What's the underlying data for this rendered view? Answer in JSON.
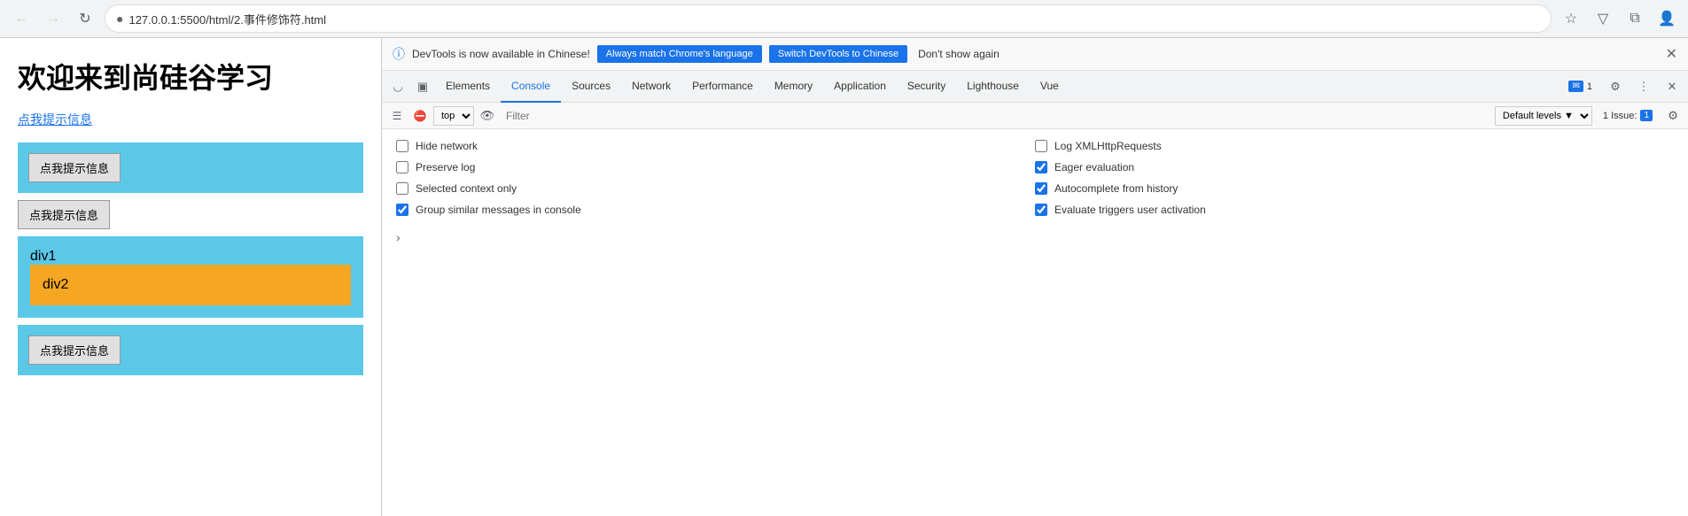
{
  "browser": {
    "url": "127.0.0.1:5500/html/2.事件修饰符.html",
    "back_title": "Back",
    "forward_title": "Forward",
    "refresh_title": "Refresh"
  },
  "webpage": {
    "title": "欢迎来到尚硅谷学习",
    "link_text": "点我提示信息",
    "btn1_label": "点我提示信息",
    "btn2_label": "点我提示信息",
    "btn3_label": "点我提示信息",
    "div1_label": "div1",
    "div2_label": "div2"
  },
  "devtools": {
    "notification": {
      "info_text": "DevTools is now available in Chinese!",
      "btn1_label": "Always match Chrome's language",
      "btn2_label": "Switch DevTools to Chinese",
      "dont_show_label": "Don't show again"
    },
    "tabs": [
      {
        "label": "Elements",
        "active": false
      },
      {
        "label": "Console",
        "active": true
      },
      {
        "label": "Sources",
        "active": false
      },
      {
        "label": "Network",
        "active": false
      },
      {
        "label": "Performance",
        "active": false
      },
      {
        "label": "Memory",
        "active": false
      },
      {
        "label": "Application",
        "active": false
      },
      {
        "label": "Security",
        "active": false
      },
      {
        "label": "Lighthouse",
        "active": false
      },
      {
        "label": "Vue",
        "active": false
      }
    ],
    "issues_badge": "1",
    "console_toolbar": {
      "top_label": "top",
      "filter_placeholder": "Filter",
      "default_levels_label": "Default levels ▼",
      "issue_label": "1 Issue:",
      "issue_count": "1"
    },
    "options": {
      "left": [
        {
          "label": "Hide network",
          "checked": false
        },
        {
          "label": "Preserve log",
          "checked": false
        },
        {
          "label": "Selected context only",
          "checked": false
        },
        {
          "label": "Group similar messages in console",
          "checked": true
        }
      ],
      "right": [
        {
          "label": "Log XMLHttpRequests",
          "checked": false
        },
        {
          "label": "Eager evaluation",
          "checked": true
        },
        {
          "label": "Autocomplete from history",
          "checked": true
        },
        {
          "label": "Evaluate triggers user activation",
          "checked": true
        }
      ]
    }
  }
}
